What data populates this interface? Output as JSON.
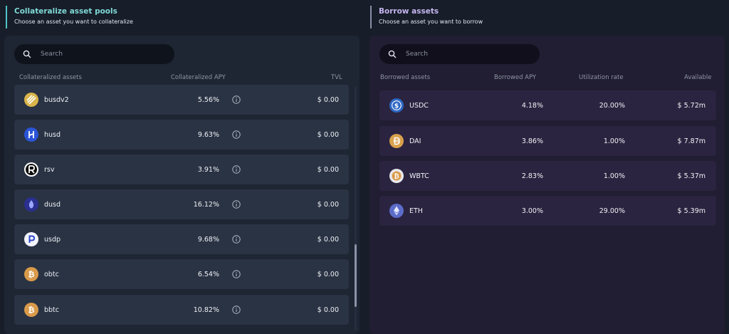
{
  "collateral": {
    "title": "Collateralize asset pools",
    "subtitle": "Choose an asset you want to collateralize",
    "search_placeholder": "Search",
    "headers": {
      "asset": "Collateralized assets",
      "apy": "Collateralized APY",
      "tvl": "TVL"
    },
    "rows": [
      {
        "name": "busdv2",
        "apy": "5.56%",
        "tvl": "$ 0.00",
        "icon": "busd-icon"
      },
      {
        "name": "husd",
        "apy": "9.63%",
        "tvl": "$ 0.00",
        "icon": "husd-icon"
      },
      {
        "name": "rsv",
        "apy": "3.91%",
        "tvl": "$ 0.00",
        "icon": "rsv-icon"
      },
      {
        "name": "dusd",
        "apy": "16.12%",
        "tvl": "$ 0.00",
        "icon": "dusd-icon"
      },
      {
        "name": "usdp",
        "apy": "9.68%",
        "tvl": "$ 0.00",
        "icon": "usdp-icon"
      },
      {
        "name": "obtc",
        "apy": "6.54%",
        "tvl": "$ 0.00",
        "icon": "bitcoin-icon"
      },
      {
        "name": "bbtc",
        "apy": "10.82%",
        "tvl": "$ 0.00",
        "icon": "bitcoin-icon"
      }
    ]
  },
  "borrow": {
    "title": "Borrow assets",
    "subtitle": "Choose an asset you want to borrow",
    "search_placeholder": "Search",
    "headers": {
      "asset": "Borrowed assets",
      "apy": "Borrowed APY",
      "utilization": "Utilization rate",
      "available": "Available"
    },
    "rows": [
      {
        "name": "USDC",
        "apy": "4.18%",
        "utilization": "20.00%",
        "available": "$ 5.72m",
        "icon": "usdc-icon"
      },
      {
        "name": "DAI",
        "apy": "3.86%",
        "utilization": "1.00%",
        "available": "$ 7.87m",
        "icon": "dai-icon"
      },
      {
        "name": "WBTC",
        "apy": "2.83%",
        "utilization": "1.00%",
        "available": "$ 5.37m",
        "icon": "wbtc-icon"
      },
      {
        "name": "ETH",
        "apy": "3.00%",
        "utilization": "29.00%",
        "available": "$ 5.39m",
        "icon": "eth-icon"
      }
    ]
  },
  "colors": {
    "teal_accent": "#7fd9d6",
    "purple_accent": "#c4b5ee",
    "bitcoin": "#d99a4a",
    "blue": "#3a6df0"
  }
}
